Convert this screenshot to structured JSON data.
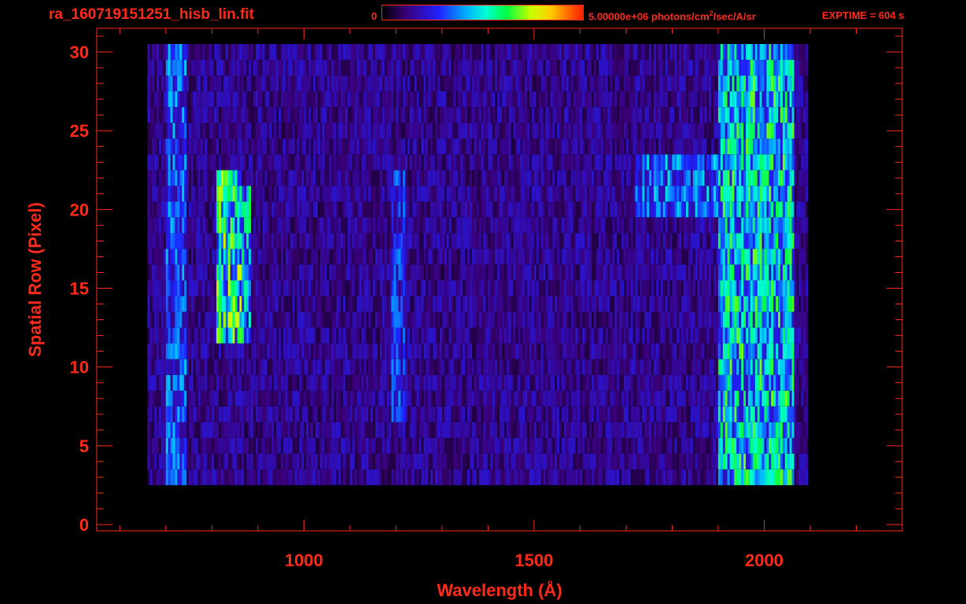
{
  "header": {
    "filename": "ra_160719151251_hisb_lin.fit",
    "colorbar_min": "0",
    "colorbar_max_prefix": "5.00000e+06 photons/cm",
    "colorbar_max_sup": "2",
    "colorbar_max_suffix": "/sec/A/sr",
    "exptime": "EXPTIME = 604 s"
  },
  "chart_data": {
    "type": "heatmap",
    "title": "ra_160719151251_hisb_lin.fit",
    "xlabel": "Wavelength (Å)",
    "ylabel": "Spatial Row (Pixel)",
    "xlim": [
      550,
      2300
    ],
    "ylim": [
      -0.4,
      31.5
    ],
    "xticks": [
      1000,
      1500,
      2000
    ],
    "xtick_labels": [
      "1000",
      "1500",
      "2000"
    ],
    "yticks": [
      0,
      5,
      10,
      15,
      20,
      25,
      30
    ],
    "ytick_labels": [
      "0",
      "5",
      "10",
      "15",
      "20",
      "25",
      "30"
    ],
    "colorscale_range": [
      0,
      5000000
    ],
    "colorscale_units": "photons/cm^2/sec/A/sr",
    "grid": false,
    "features": [
      {
        "x_range": [
          660,
          2090
        ],
        "y_range": [
          3,
          30
        ],
        "intensity": 0.18
      },
      {
        "x_range": [
          700,
          740
        ],
        "y_range": [
          3,
          30
        ],
        "intensity": 0.38
      },
      {
        "x_range": [
          810,
          860
        ],
        "y_range": [
          12,
          22
        ],
        "intensity": 0.62
      },
      {
        "x_range": [
          860,
          880
        ],
        "y_range": [
          12,
          21
        ],
        "intensity": 0.5
      },
      {
        "x_range": [
          1190,
          1215
        ],
        "y_range": [
          7,
          22
        ],
        "intensity": 0.32
      },
      {
        "x_range": [
          1720,
          2020
        ],
        "y_range": [
          20,
          23
        ],
        "intensity": 0.4
      },
      {
        "x_range": [
          1900,
          2060
        ],
        "y_range": [
          3,
          30
        ],
        "intensity": 0.55
      }
    ]
  }
}
